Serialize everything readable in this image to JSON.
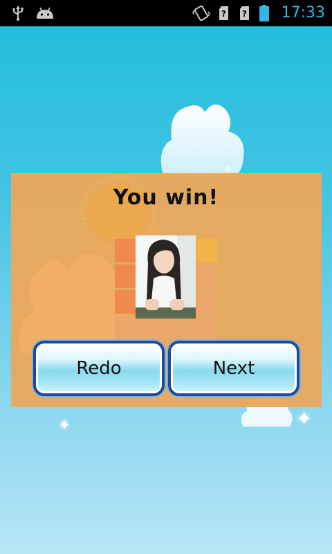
{
  "status_bar": {
    "time": "17:33",
    "left_icons": [
      "usb-icon",
      "android-debug-icon"
    ],
    "right_icons": [
      "vibrate-icon",
      "no-sim-icon",
      "no-sim-icon",
      "battery-icon"
    ],
    "accent_color": "#33b5e5"
  },
  "dialog": {
    "title": "You win!",
    "background_color": "#eba85c",
    "redo_label": "Redo",
    "next_label": "Next"
  }
}
